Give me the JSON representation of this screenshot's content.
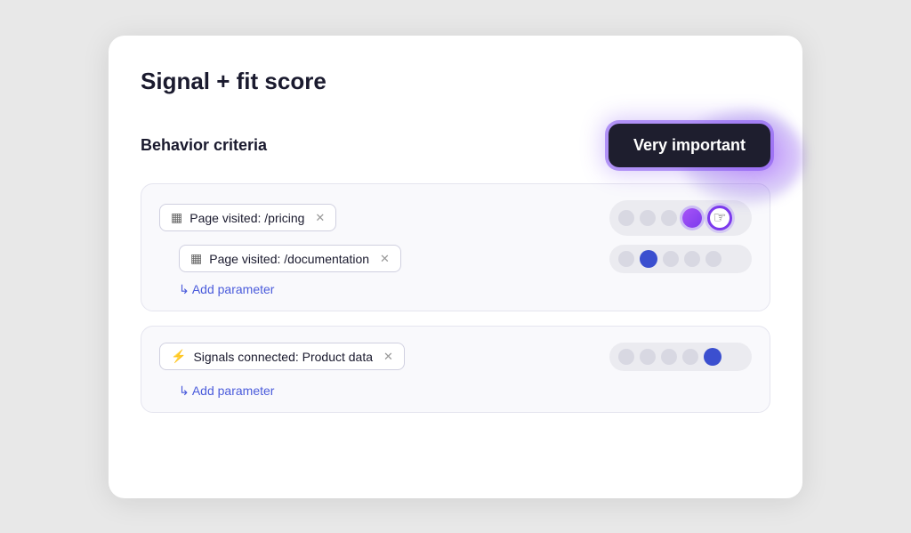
{
  "card": {
    "title": "Signal + fit score"
  },
  "behavior_criteria": {
    "label": "Behavior criteria"
  },
  "tooltip": {
    "text": "Very important"
  },
  "rows": [
    {
      "id": "pricing",
      "tag_icon": "🗓",
      "tag_label": "Page visited:  /pricing",
      "has_cursor": true,
      "dot_states": [
        "empty",
        "empty",
        "empty",
        "filled-purple",
        "cursor"
      ]
    },
    {
      "id": "documentation",
      "tag_icon": "🗓",
      "tag_label": "Page visited:  /documentation",
      "has_cursor": false,
      "dot_states": [
        "empty",
        "filled-blue",
        "empty",
        "empty",
        "empty"
      ],
      "is_sub": true
    }
  ],
  "add_param_1": "↳ Add parameter",
  "second_card": {
    "tag_icon": "⚡",
    "tag_label": "Signals connected:  Product data",
    "dot_states": [
      "empty",
      "empty",
      "empty",
      "empty",
      "filled-blue"
    ]
  },
  "add_param_2": "↳ Add parameter"
}
